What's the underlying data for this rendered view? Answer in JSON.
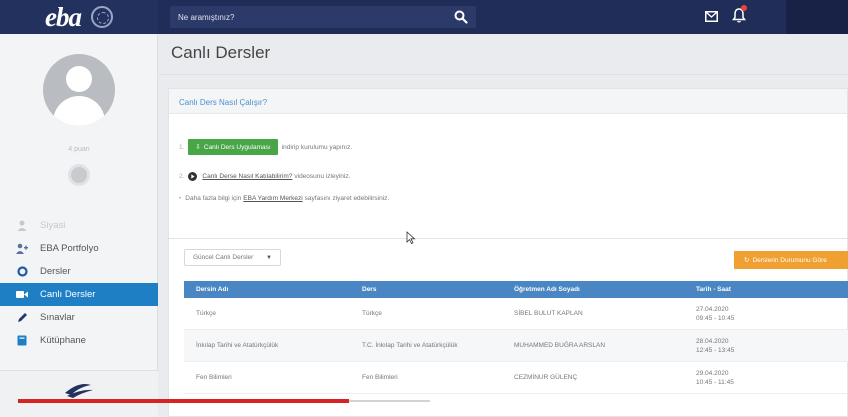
{
  "header": {
    "logo_text": "eba",
    "search_placeholder": "Ne aramıştınız?"
  },
  "sidebar": {
    "points": "4 puan",
    "items": [
      {
        "label": "Siyasi",
        "icon": "user-icon"
      },
      {
        "label": "EBA Portfolyo",
        "icon": "portfolio-icon"
      },
      {
        "label": "Dersler",
        "icon": "lessons-icon"
      },
      {
        "label": "Canlı Dersler",
        "icon": "video-icon"
      },
      {
        "label": "Sınavlar",
        "icon": "pencil-icon"
      },
      {
        "label": "Kütüphane",
        "icon": "book-icon"
      }
    ],
    "active_index": 3
  },
  "main": {
    "title": "Canlı Dersler",
    "info": {
      "heading": "Canlı Ders Nasıl Çalışır?",
      "step1_num": "1.",
      "step1_button": "Canlı Ders Uygulaması",
      "step1_text": "indirip kurulumu yapınız.",
      "step2_num": "2.",
      "step2_link": "Canlı Derse Nasıl Katılabilirim?",
      "step2_text": "videosunu izleyiniz.",
      "step3_bullet": "•",
      "step3_pre": "Daha fazla bilgi için",
      "step3_link": "EBA Yardım Merkezi",
      "step3_post": "sayfasını ziyaret edebilirsiniz."
    },
    "lessons": {
      "filter_value": "Güncel Canlı Dersler",
      "status_button": "Derslerin Durumunu Göre",
      "columns": [
        "Dersin Adı",
        "Ders",
        "Öğretmen Adı Soyadı",
        "Tarih - Saat"
      ],
      "rows": [
        {
          "name": "Türkçe",
          "course": "Türkçe",
          "teacher": "SİBEL BULUT KAPLAN",
          "date": "27.04.2020",
          "time": "09:45 - 10:45"
        },
        {
          "name": "İnkılap Tarihi ve Atatürkçülük",
          "course": "T.C. İnkılap Tarihi ve Atatürkçülük",
          "teacher": "MUHAMMED BUĞRA ARSLAN",
          "date": "28.04.2020",
          "time": "12:45 - 13:45"
        },
        {
          "name": "Fen Bilimleri",
          "course": "Fen Bilimleri",
          "teacher": "CEZMİNUR GÜLENÇ",
          "date": "29.04.2020",
          "time": "10:45 - 11:45"
        }
      ]
    }
  },
  "video": {
    "progress": 0.39
  },
  "colors": {
    "topbar": "#1f2d58",
    "active": "#1e7fc4",
    "table_header": "#4a86c4",
    "green_button": "#48a548",
    "orange_button": "#f0a030",
    "progress": "#d62323"
  }
}
